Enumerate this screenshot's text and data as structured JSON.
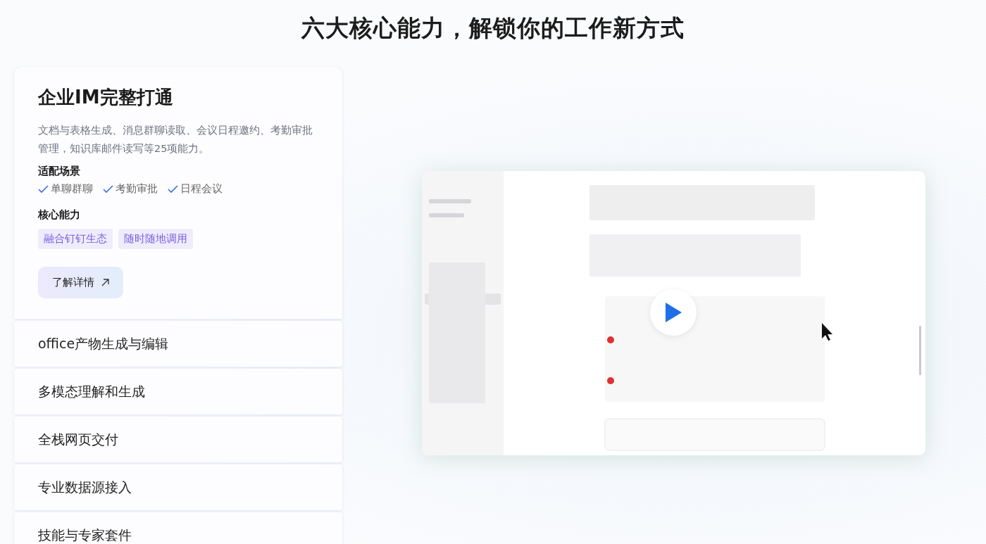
{
  "heading": "六大核心能力，解锁你的工作新方式",
  "features": [
    {
      "title": "企业IM完整打通",
      "expanded": true,
      "description": "文档与表格生成、消息群聊读取、会议日程邀约、考勤审批管理，知识库邮件读写等25项能力。",
      "scenarios_label": "适配场景",
      "scenarios": [
        "单聊群聊",
        "考勤审批",
        "日程会议"
      ],
      "abilities_label": "核心能力",
      "abilities": [
        "融合钉钉生态",
        "随时随地调用"
      ],
      "button": "了解详情"
    },
    {
      "title": "office产物生成与编辑",
      "expanded": false
    },
    {
      "title": "多模态理解和生成",
      "expanded": false
    },
    {
      "title": "全栈网页交付",
      "expanded": false
    },
    {
      "title": "专业数据源接入",
      "expanded": false
    },
    {
      "title": "技能与专家套件",
      "expanded": false
    }
  ]
}
